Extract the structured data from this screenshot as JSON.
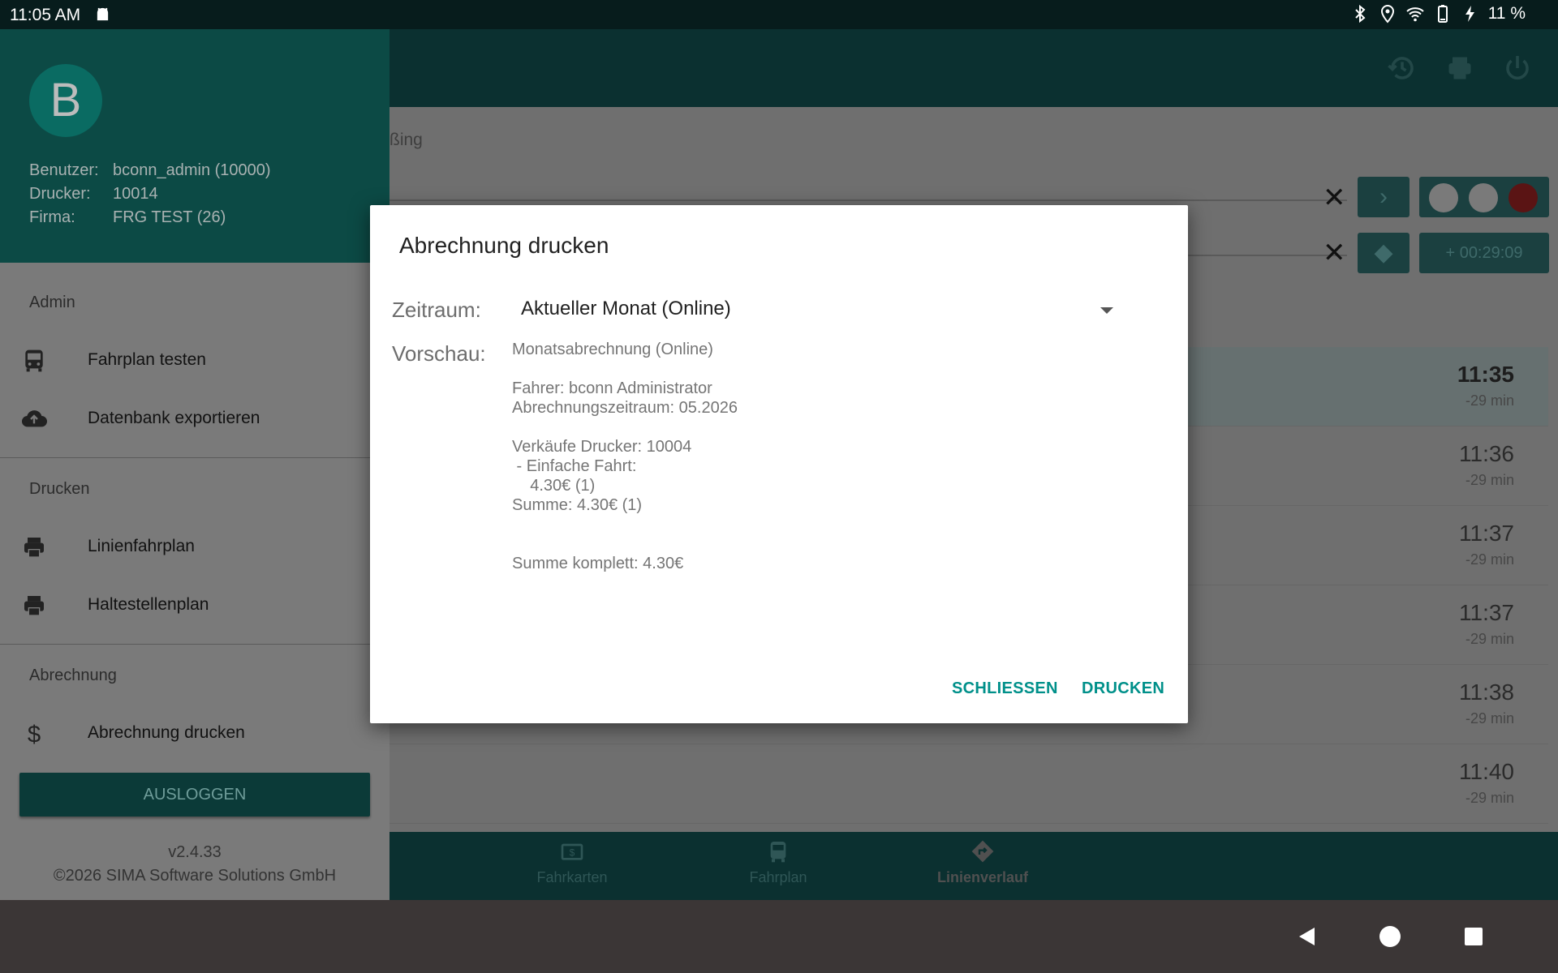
{
  "status_bar": {
    "time": "11:05 AM",
    "battery_text": "11 %",
    "icons": [
      "android-icon",
      "bluetooth-icon",
      "location-icon",
      "wifi-icon",
      "battery-icon",
      "charging-icon"
    ]
  },
  "background": {
    "subtitle": "ßing",
    "delay_label": "+ 00:29:09",
    "rows": [
      {
        "time": "11:35",
        "delta": "-29 min"
      },
      {
        "time": "11:36",
        "delta": "-29 min"
      },
      {
        "time": "11:37",
        "delta": "-29 min"
      },
      {
        "time": "11:37",
        "delta": "-29 min"
      },
      {
        "time": "11:38",
        "delta": "-29 min"
      },
      {
        "time": "11:40",
        "delta": "-29 min"
      }
    ],
    "bottom_nav": [
      {
        "label": "Fahrkarten",
        "icon": "ticket-icon"
      },
      {
        "label": "Fahrplan",
        "icon": "bus-icon"
      },
      {
        "label": "Linienverlauf",
        "icon": "route-icon"
      }
    ],
    "traffic_light_colors": [
      "#7a7a7a",
      "#7a7a7a",
      "#5a1414"
    ]
  },
  "drawer": {
    "avatar_letter": "B",
    "user_info": [
      {
        "key": "Benutzer:",
        "value": "bconn_admin (10000)"
      },
      {
        "key": "Drucker:",
        "value": "10014"
      },
      {
        "key": "Firma:",
        "value": "FRG TEST (26)"
      }
    ],
    "sections": {
      "admin": "Admin",
      "drucken": "Drucken",
      "abrechnung": "Abrechnung"
    },
    "items": {
      "fahrplan_testen": "Fahrplan testen",
      "datenbank_exportieren": "Datenbank exportieren",
      "linienfahrplan": "Linienfahrplan",
      "haltestellenplan": "Haltestellenplan",
      "abrechnung_drucken": "Abrechnung drucken"
    },
    "logout_label": "AUSLOGGEN",
    "version": "v2.4.33",
    "copyright": "©2026 SIMA Software Solutions GmbH"
  },
  "dialog": {
    "title": "Abrechnung drucken",
    "zeitraum_label": "Zeitraum:",
    "zeitraum_value": "Aktueller Monat (Online)",
    "vorschau_label": "Vorschau:",
    "preview_text": "Monatsabrechnung (Online)\n\nFahrer: bconn Administrator\nAbrechnungszeitraum: 05.2026\n\nVerkäufe Drucker: 10004\n - Einfache Fahrt:\n    4.30€ (1)\nSumme: 4.30€ (1)\n\n\nSumme komplett: 4.30€",
    "close_label": "SCHLIESSEN",
    "print_label": "DRUCKEN"
  },
  "colors": {
    "accent": "#00908a",
    "header_teal": "#0c4a45"
  }
}
